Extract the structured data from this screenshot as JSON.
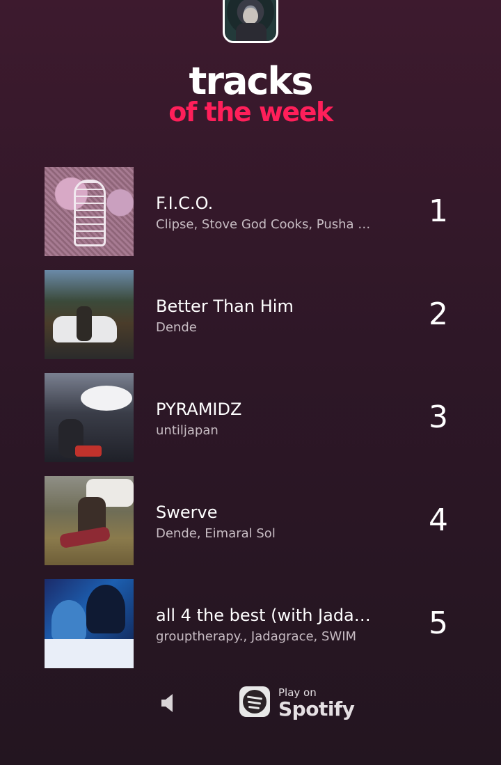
{
  "header": {
    "title_line1": "tracks",
    "title_line2": "of the week",
    "accent_color": "#ff1f5a"
  },
  "tracks": [
    {
      "rank": "1",
      "title": "F.I.C.O.",
      "artists": "Clipse, Stove God Cooks, Pusha …"
    },
    {
      "rank": "2",
      "title": "Better Than Him",
      "artists": "Dende"
    },
    {
      "rank": "3",
      "title": "PYRAMIDZ",
      "artists": "untiljapan"
    },
    {
      "rank": "4",
      "title": "Swerve",
      "artists": "Dende, Eimaral Sol"
    },
    {
      "rank": "5",
      "title": "all 4 the best (with Jada…",
      "artists": "grouptherapy., Jadagrace, SWIM"
    }
  ],
  "footer": {
    "speaker_icon": "speaker-icon",
    "play_on_label": "Play on",
    "spotify_label": "Spotify"
  }
}
